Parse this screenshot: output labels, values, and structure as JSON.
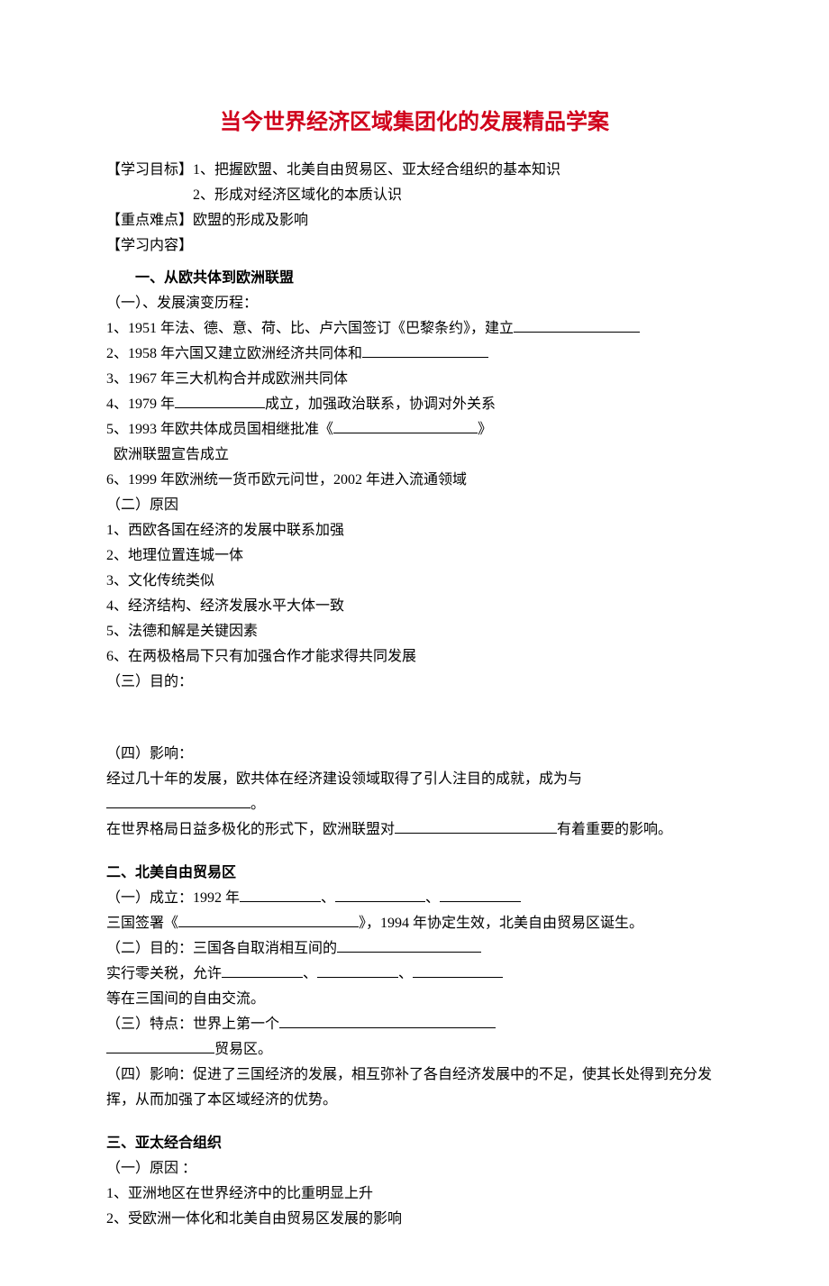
{
  "title": "当今世界经济区域集团化的发展精品学案",
  "objectives": {
    "label": "【学习目标】",
    "item1": "1、把握欧盟、北美自由贸易区、亚太经合组织的基本知识",
    "item2": "2、形成对经济区域化的本质认识"
  },
  "focus": {
    "label": "【重点难点】",
    "text": "欧盟的形成及影响"
  },
  "content_label": "【学习内容】",
  "sec1": {
    "heading": "一、从欧共体到欧洲联盟",
    "p1_label": "（一）、发展演变历程：",
    "i1a": "1、1951 年法、德、意、荷、比、卢六国签订《巴黎条约》，建立",
    "i2a": "2、1958 年六国又建立欧洲经济共同体和",
    "i3": "3、1967 年三大机构合并成欧洲共同体",
    "i4a": "4、1979 年",
    "i4b": "成立，加强政治联系，协调对外关系",
    "i5a": "5、1993 年欧共体成员国相继批准《",
    "i5b": "》",
    "i5c": "欧洲联盟宣告成立",
    "i6": "6、1999 年欧洲统一货币欧元问世，2002 年进入流通领域",
    "p2_label": "（二）原因",
    "r1": "1、西欧各国在经济的发展中联系加强",
    "r2": "2、地理位置连城一体",
    "r3": "3、文化传统类似",
    "r4": "4、经济结构、经济发展水平大体一致",
    "r5": "5、法德和解是关键因素",
    "r6": "6、在两极格局下只有加强合作才能求得共同发展",
    "p3_label": "（三）目的：",
    "p4_label": "（四）影响：",
    "e1a": "经过几十年的发展，欧共体在经济建设领域取得了引人注目的成就，成为与",
    "e1b": "。",
    "e2a": "在世界格局日益多极化的形式下，欧洲联盟对",
    "e2b": "有着重要的影响。"
  },
  "sec2": {
    "heading": "二、北美自由贸易区",
    "i1a": "（一）成立：1992 年",
    "sep": "、",
    "i1b": "三国签署《",
    "i1c": "》，1994 年协定生效，北美自由贸易区诞生。",
    "i2a": "（二）目的：三国各自取消相互间的",
    "i2b": "实行零关税，允许",
    "i2c": "等在三国间的自由交流。",
    "i3a": "（三）特点：世界上第一个",
    "i3b": "贸易区。",
    "i4": "（四）影响：促进了三国经济的发展，相互弥补了各自经济发展中的不足，使其长处得到充分发挥，从而加强了本区域经济的优势。"
  },
  "sec3": {
    "heading": "三、亚太经合组织",
    "i1": "（一）原因 ：",
    "r1": "1、亚洲地区在世界经济中的比重明显上升",
    "r2": "2、受欧洲一体化和北美自由贸易区发展的影响"
  }
}
